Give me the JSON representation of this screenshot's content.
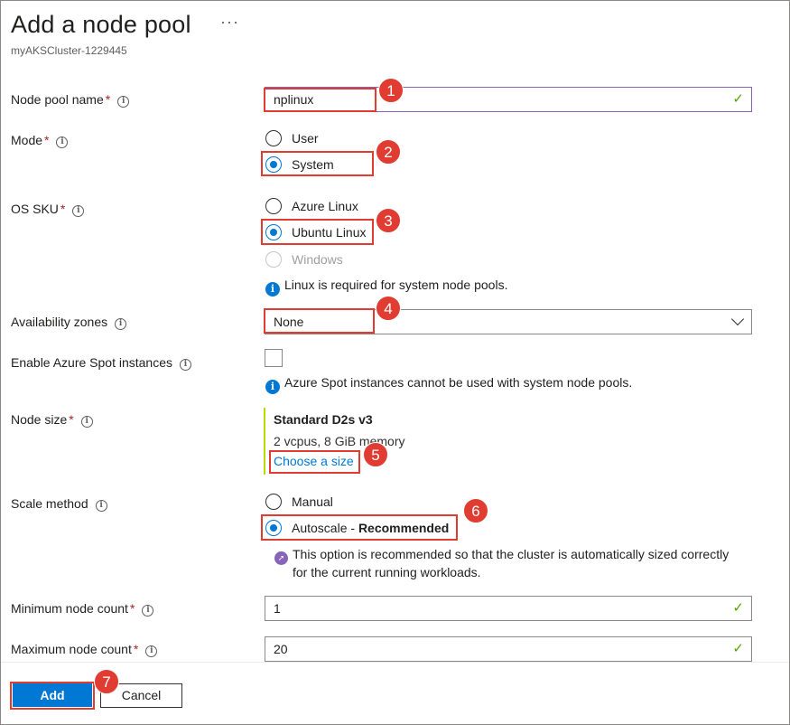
{
  "header": {
    "title": "Add a node pool",
    "more_label": "···",
    "subtitle": "myAKSCluster-1229445"
  },
  "fields": {
    "node_pool_name": {
      "label": "Node pool name",
      "required": "*",
      "value": "nplinux"
    },
    "mode": {
      "label": "Mode",
      "required": "*",
      "options": [
        "User",
        "System"
      ],
      "selected": "System"
    },
    "os_sku": {
      "label": "OS SKU",
      "required": "*",
      "options": [
        "Azure Linux",
        "Ubuntu Linux",
        "Windows"
      ],
      "selected": "Ubuntu Linux",
      "disabled": [
        "Windows"
      ],
      "note": "Linux is required for system node pools."
    },
    "availability_zones": {
      "label": "Availability zones",
      "value": "None"
    },
    "spot": {
      "label": "Enable Azure Spot instances",
      "checked": false,
      "note": "Azure Spot instances cannot be used with system node pools."
    },
    "node_size": {
      "label": "Node size",
      "required": "*",
      "name": "Standard D2s v3",
      "detail": "2 vcpus, 8 GiB memory",
      "link": "Choose a size"
    },
    "scale_method": {
      "label": "Scale method",
      "options": [
        "Manual",
        "Autoscale - "
      ],
      "recommended": "Recommended",
      "selected": "Autoscale",
      "note_line1": "This option is recommended so that the cluster is automatically sized correctly",
      "note_line2": "for the current running workloads."
    },
    "min_count": {
      "label": "Minimum node count",
      "required": "*",
      "value": "1"
    },
    "max_count": {
      "label": "Maximum node count",
      "required": "*",
      "value": "20"
    }
  },
  "footer": {
    "add_label": "Add",
    "cancel_label": "Cancel"
  },
  "callouts": [
    "1",
    "2",
    "3",
    "4",
    "5",
    "6",
    "7"
  ],
  "icons": {
    "info": "info-icon",
    "check": "checkmark-icon",
    "chevron": "chevron-down-icon",
    "rocket": "rocket-icon"
  },
  "colors": {
    "accent": "#0078d4",
    "callout": "#e03c31",
    "valid": "#57a300",
    "required": "#a4262c"
  }
}
